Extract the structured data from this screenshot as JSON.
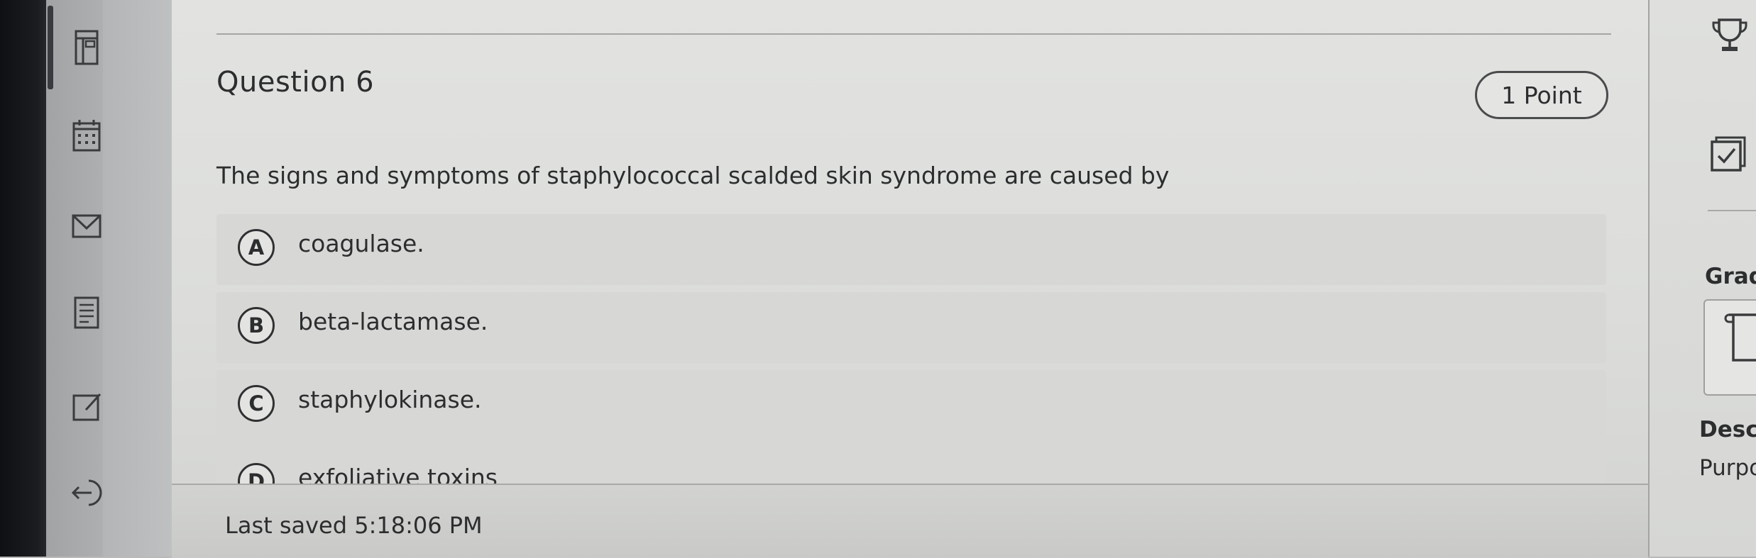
{
  "question": {
    "title": "Question 6",
    "points": "1 Point",
    "text": "The signs and symptoms of staphylococcal scalded skin syndrome are caused by",
    "choices": [
      {
        "letter": "A",
        "label": "coagulase."
      },
      {
        "letter": "B",
        "label": "beta-lactamase."
      },
      {
        "letter": "C",
        "label": "staphylokinase."
      },
      {
        "letter": "D",
        "label": "exfoliative toxins"
      }
    ]
  },
  "footer": {
    "last_saved": "Last saved 5:18:06 PM"
  },
  "right_panel": {
    "grade_label": "Grad",
    "description_label": "Desc",
    "description_text": "Purpo"
  },
  "icons": {
    "nav": [
      "calculator-icon",
      "calendar-icon",
      "mail-icon",
      "document-list-icon",
      "edit-icon",
      "exit-icon"
    ],
    "right": [
      "trophy-icon",
      "checkbox-icon",
      "bookmark-icon"
    ]
  },
  "colors": {
    "text": "#2c2d2e",
    "page_background": "#e0e1df",
    "choice_background": "#d7d8d6",
    "sidebar": "#a8a9aa"
  }
}
